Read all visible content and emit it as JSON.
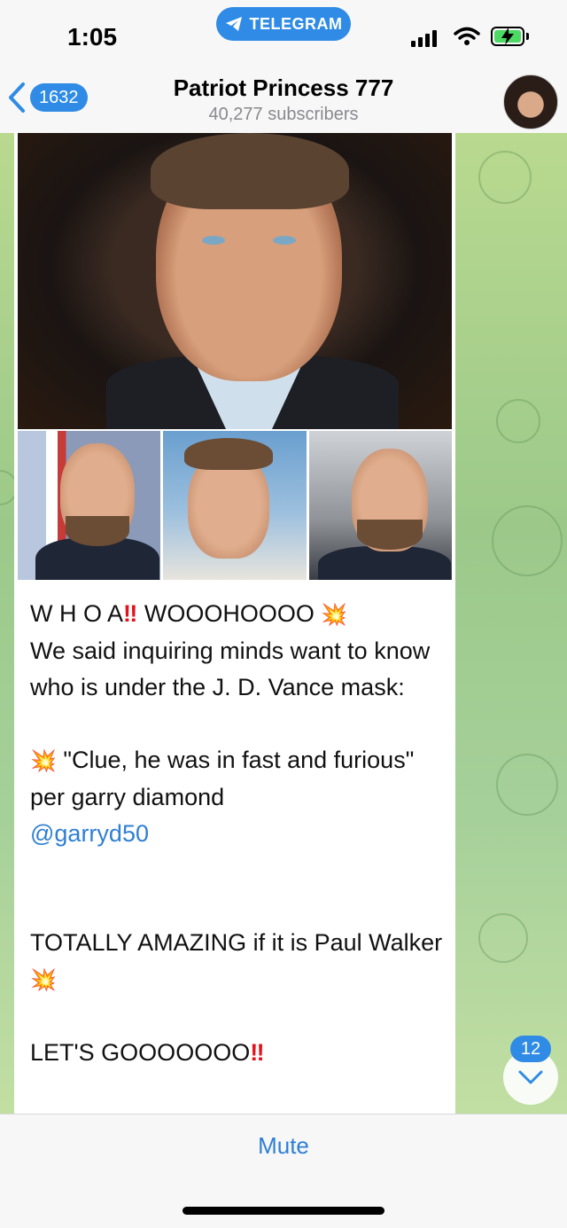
{
  "status_bar": {
    "time": "1:05",
    "app_pill": "TELEGRAM"
  },
  "header": {
    "back_count": "1632",
    "title": "Patriot Princess 777",
    "subtitle": "40,277 subscribers"
  },
  "message": {
    "line1_text": "W H O A",
    "line1_bang": "‼",
    "line1_rest": " WOOOHOOOO ",
    "burst": "💥",
    "para1": "We said inquiring minds want to know who is under the J. D. Vance mask:",
    "para2": "\"Clue, he was in fast and furious\" per garry diamond",
    "mention": "@garryd50",
    "para3": "TOTALLY AMAZING if it is Paul Walker ",
    "para4": "LET'S GOOOOOOO",
    "para4_bang": "‼"
  },
  "scroll": {
    "unread_count": "12"
  },
  "bottom": {
    "mute_label": "Mute"
  },
  "colors": {
    "accent": "#2f8be6",
    "link": "#2f7fd4"
  }
}
